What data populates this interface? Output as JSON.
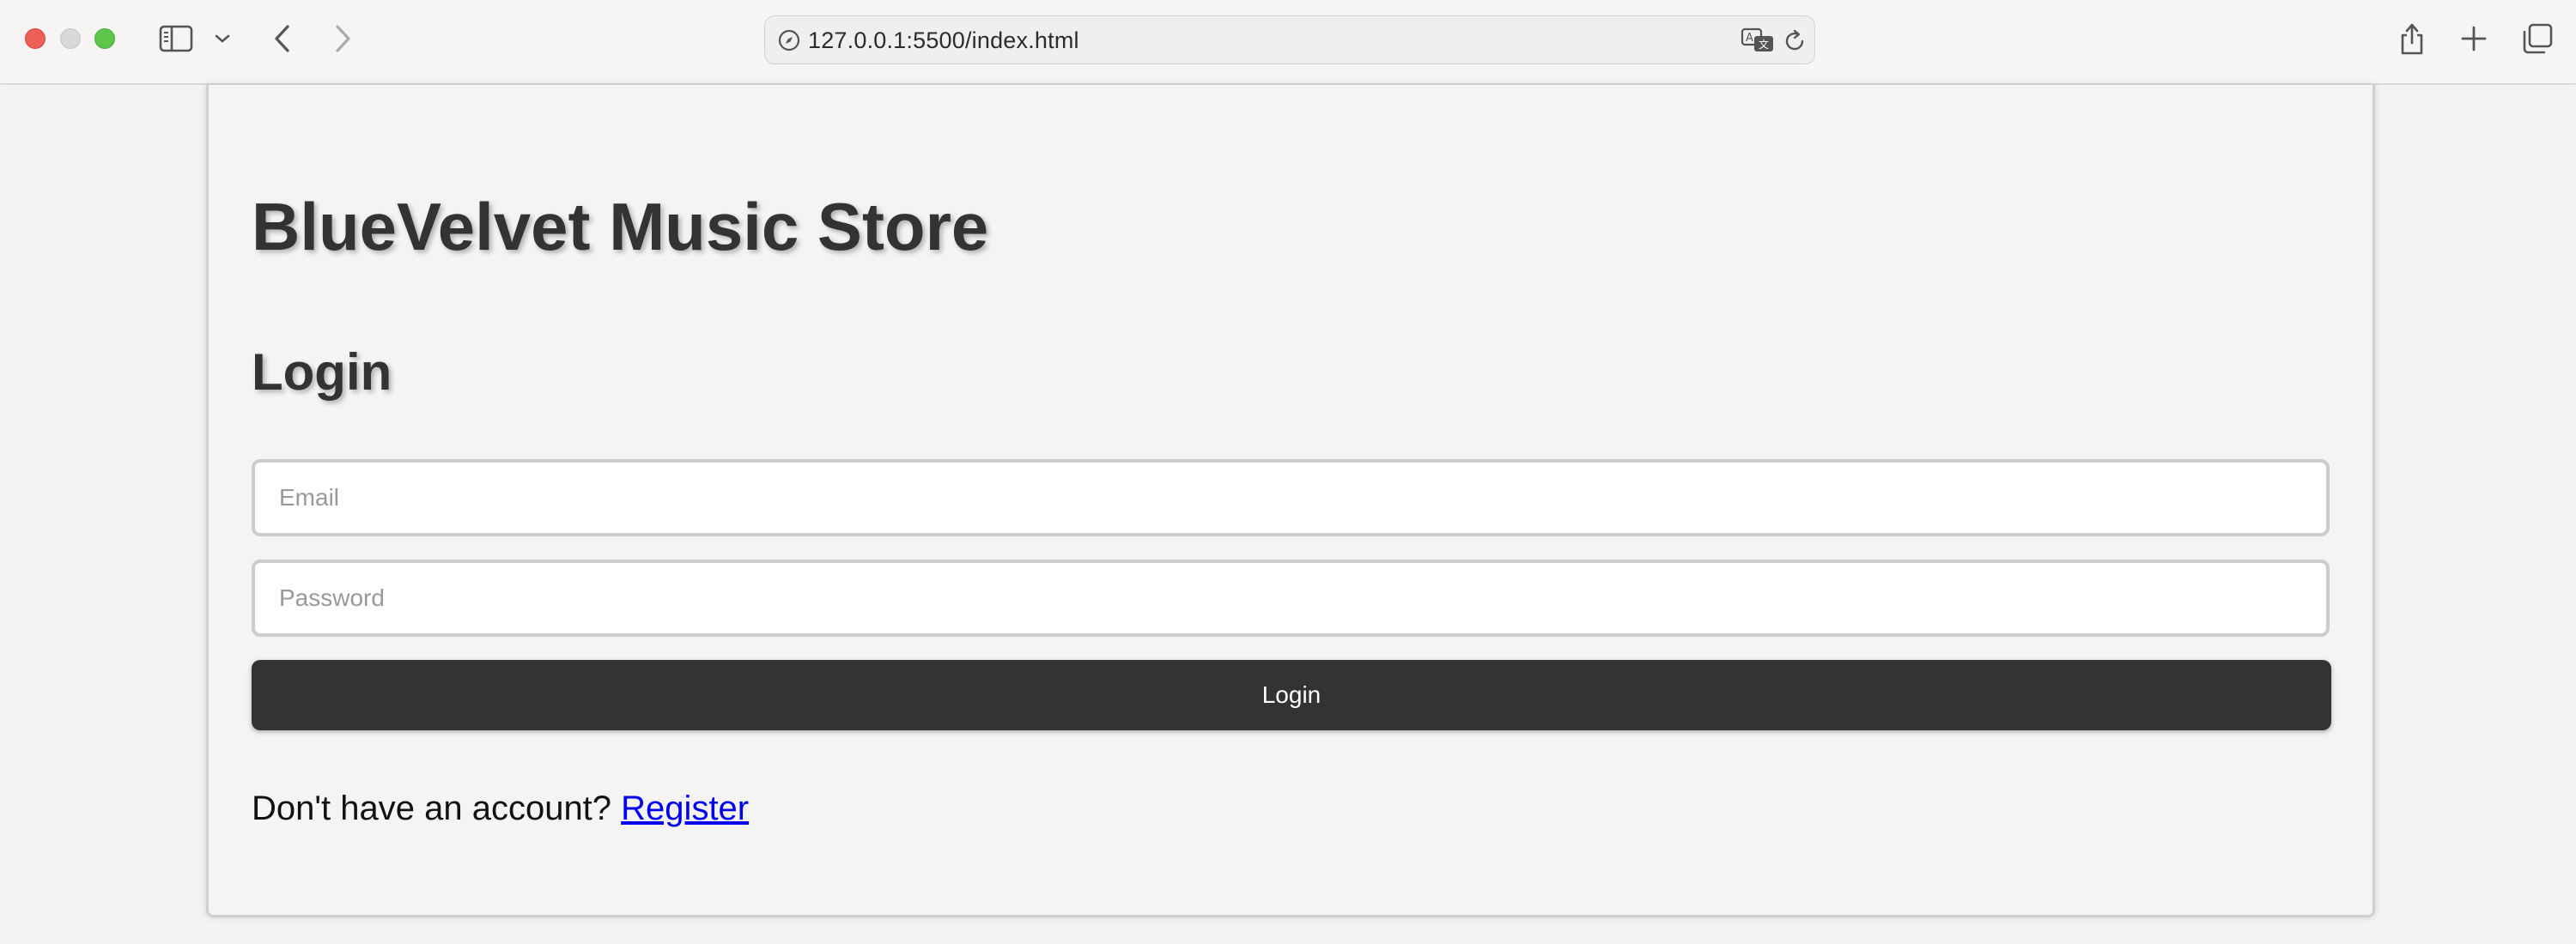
{
  "browser": {
    "url": "127.0.0.1:5500/index.html",
    "icons": {
      "sidebar": "sidebar-icon",
      "chevron": "chevron-down-icon",
      "back": "chevron-left-icon",
      "forward": "chevron-right-icon",
      "site": "compass-icon",
      "translate": "translate-icon",
      "reload": "reload-icon",
      "share": "share-icon",
      "new_tab": "plus-icon",
      "tabs": "tab-overview-icon"
    }
  },
  "page": {
    "site_title": "BlueVelvet Music Store",
    "section_title": "Login",
    "email_placeholder": "Email",
    "password_placeholder": "Password",
    "login_button": "Login",
    "register_prompt": "Don't have an account?",
    "register_link": "Register"
  },
  "colors": {
    "button_bg": "#333333",
    "link": "#0000ee",
    "page_bg": "#f4f4f4"
  }
}
